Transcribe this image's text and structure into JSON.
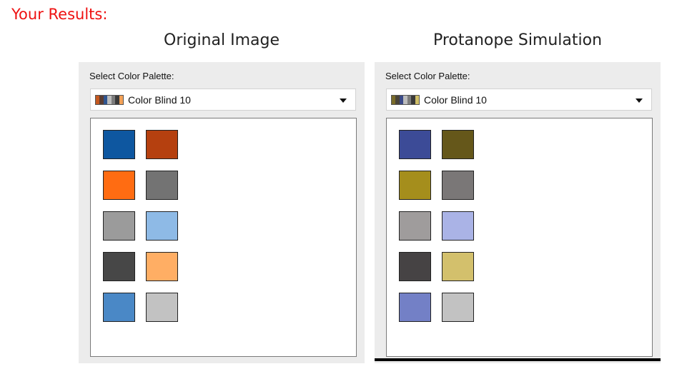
{
  "heading": "Your Results:",
  "panels": [
    {
      "title": "Original Image",
      "select_label": "Select Color Palette:",
      "dropdown_value": "Color Blind 10",
      "thumb_colors": [
        "#c5581f",
        "#5a3d33",
        "#2f5590",
        "#bcbcbc",
        "#7c7c7c",
        "#3a3a3a",
        "#f2a056"
      ],
      "swatch_colors": [
        "#0e57a0",
        "#b5400f",
        "#ff6c12",
        "#737373",
        "#9b9b9b",
        "#8ebae6",
        "#474747",
        "#ffae64",
        "#4a88c6",
        "#c2c2c2"
      ]
    },
    {
      "title": "Protanope Simulation",
      "select_label": "Select Color Palette:",
      "dropdown_value": "Color Blind 10",
      "thumb_colors": [
        "#7a6c2a",
        "#4a4438",
        "#3b4a88",
        "#bcbcbc",
        "#7c7c7c",
        "#3a3a3a",
        "#d0bf68"
      ],
      "swatch_colors": [
        "#3c4b97",
        "#65571a",
        "#a58e1c",
        "#7a7777",
        "#9f9c9c",
        "#aab3e6",
        "#464344",
        "#d3c06c",
        "#7380c6",
        "#c2c2c2"
      ]
    }
  ]
}
